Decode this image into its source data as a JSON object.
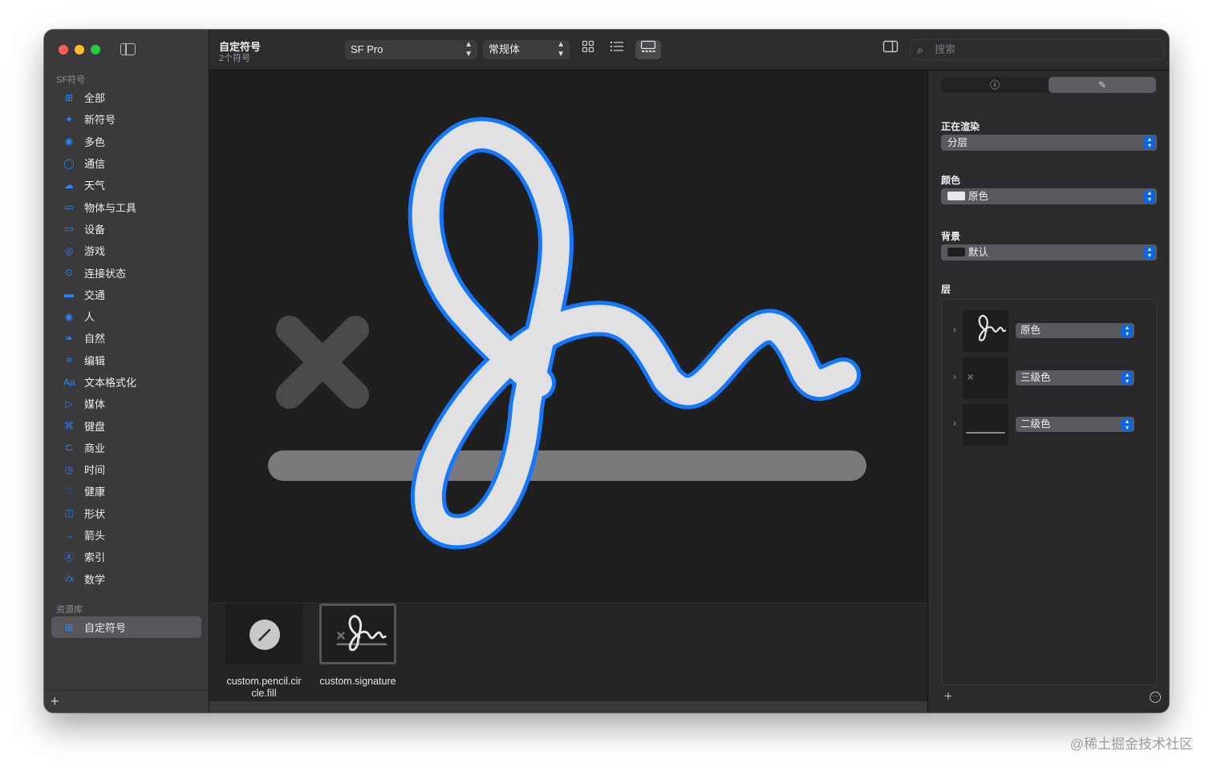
{
  "sidebar": {
    "section_symbols": "SF符号",
    "items": [
      {
        "label": "全部",
        "icon": "grid-icon",
        "glyph": "⊞"
      },
      {
        "label": "新符号",
        "icon": "sparkle-icon",
        "glyph": "✦"
      },
      {
        "label": "多色",
        "icon": "palette-icon",
        "glyph": "◉"
      },
      {
        "label": "通信",
        "icon": "message-icon",
        "glyph": "◯"
      },
      {
        "label": "天气",
        "icon": "cloud-sun-icon",
        "glyph": "☁"
      },
      {
        "label": "物体与工具",
        "icon": "folder-icon",
        "glyph": "▭"
      },
      {
        "label": "设备",
        "icon": "display-icon",
        "glyph": "▭"
      },
      {
        "label": "游戏",
        "icon": "gamecontroller-icon",
        "glyph": "◎"
      },
      {
        "label": "连接状态",
        "icon": "antenna-icon",
        "glyph": "⊙"
      },
      {
        "label": "交通",
        "icon": "car-icon",
        "glyph": "▬"
      },
      {
        "label": "人",
        "icon": "person-circle-icon",
        "glyph": "◉"
      },
      {
        "label": "自然",
        "icon": "leaf-icon",
        "glyph": "❧"
      },
      {
        "label": "编辑",
        "icon": "slider-icon",
        "glyph": "≡"
      },
      {
        "label": "文本格式化",
        "icon": "textformat-icon",
        "glyph": "Aa"
      },
      {
        "label": "媒体",
        "icon": "playpause-icon",
        "glyph": "▷"
      },
      {
        "label": "键盘",
        "icon": "command-icon",
        "glyph": "⌘"
      },
      {
        "label": "商业",
        "icon": "cart-icon",
        "glyph": "⊏"
      },
      {
        "label": "时间",
        "icon": "clock-icon",
        "glyph": "◷"
      },
      {
        "label": "健康",
        "icon": "heart-icon",
        "glyph": "♡"
      },
      {
        "label": "形状",
        "icon": "shapes-icon",
        "glyph": "◫"
      },
      {
        "label": "箭头",
        "icon": "arrow-right-icon",
        "glyph": "→"
      },
      {
        "label": "索引",
        "icon": "a-circle-icon",
        "glyph": "Ⓐ"
      },
      {
        "label": "数学",
        "icon": "sqrt-icon",
        "glyph": "√x"
      }
    ],
    "section_library": "资源库",
    "library_items": [
      {
        "label": "自定符号",
        "icon": "grid-icon",
        "glyph": "⊞"
      }
    ],
    "add": "+"
  },
  "toolbar": {
    "title": "自定符号",
    "subtitle": "2个符号",
    "font_popup": "SF Pro",
    "weight_popup": "常规体",
    "search_placeholder": "搜索"
  },
  "gallery": {
    "items": [
      {
        "label": "custom.pencil.circle.fill",
        "icon": "pencil-circle-icon"
      },
      {
        "label": "custom.signature",
        "icon": "signature-icon"
      }
    ]
  },
  "inspector": {
    "tab_info_glyph": "ⓘ",
    "tab_brush_glyph": "✎",
    "rendering_label": "正在渲染",
    "rendering_value": "分层",
    "color_label": "颜色",
    "color_value": "原色",
    "background_label": "背景",
    "background_value": "默认",
    "layers_label": "层",
    "layers": [
      {
        "value": "原色"
      },
      {
        "value": "三级色"
      },
      {
        "value": "二级色"
      }
    ],
    "add": "+",
    "more": "···"
  },
  "colors": {
    "accent": "#0a66e4",
    "signature_outline": "#1478ff",
    "signature_fill": "#e1e1e3",
    "x_mark": "#4a4a4c",
    "baseline": "#7a7a7c"
  },
  "watermark": "@稀土掘金技术社区"
}
